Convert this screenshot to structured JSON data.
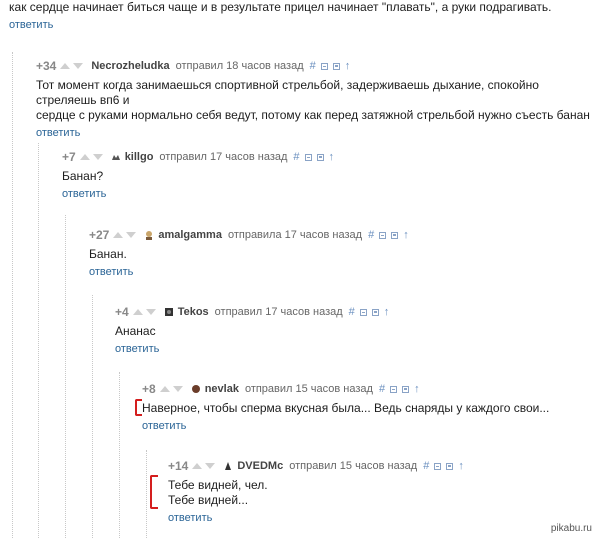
{
  "top": {
    "text": "как сердце начинает биться чаще и в результате прицел начинает \"плавать\", а руки подрагивать.",
    "reply": "ответить"
  },
  "icons": {
    "hash": "#",
    "up": "↑"
  },
  "comments": [
    {
      "rating": "+34",
      "author": "Necrozheludka",
      "meta": "отправил 18 часов назад",
      "lines": [
        "Тот момент когда занимаешься спортивной стрельбой, задерживаешь дыхание, спокойно стреляешь вп6 и",
        "сердце с руками нормально себя ведут, потому как перед затяжной стрельбой нужно съесть банан"
      ],
      "reply": "ответить"
    },
    {
      "rating": "+7",
      "author": "killgo",
      "meta": "отправил 17 часов назад",
      "lines": [
        "Банан?"
      ],
      "reply": "ответить"
    },
    {
      "rating": "+27",
      "author": "amalgamma",
      "meta": "отправила 17 часов назад",
      "lines": [
        "Банан."
      ],
      "reply": "ответить"
    },
    {
      "rating": "+4",
      "author": "Tekos",
      "meta": "отправил 17 часов назад",
      "lines": [
        "Ананас"
      ],
      "reply": "ответить"
    },
    {
      "rating": "+8",
      "author": "nevlak",
      "meta": "отправил 15 часов назад",
      "lines": [
        "Наверное, чтобы сперма вкусная была... Ведь снаряды у каждого свои..."
      ],
      "reply": "ответить"
    },
    {
      "rating": "+14",
      "author": "DVEDMc",
      "meta": "отправил 15 часов назад",
      "lines": [
        "Тебе видней, чел.",
        "Тебе видней..."
      ],
      "reply": "ответить"
    }
  ],
  "watermark": "pikabu.ru"
}
